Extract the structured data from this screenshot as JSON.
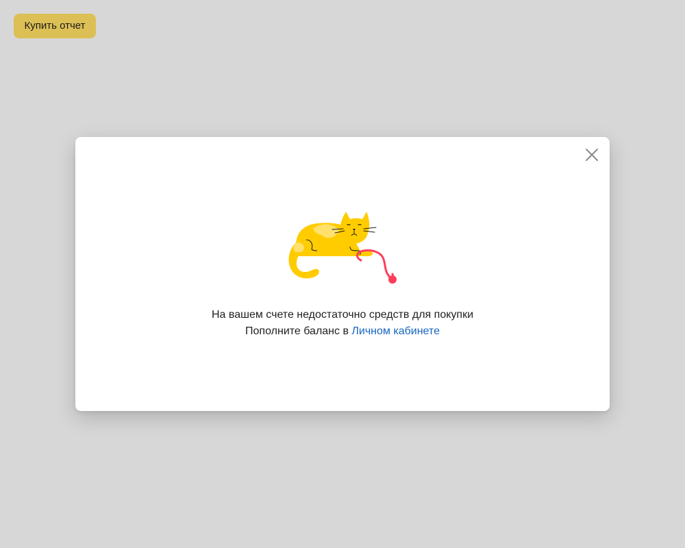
{
  "toolbar": {
    "buy_report_label": "Купить отчет"
  },
  "modal": {
    "message_line1": "На вашем счете недостаточно средств для покупки",
    "message_line2_prefix": "Пополните баланс в ",
    "cabinet_link_label": "Личном кабинете",
    "close_icon": "close-icon",
    "illustration": "cat-with-yarn-icon"
  },
  "colors": {
    "background": "#d7d7d7",
    "button": "#dcbf55",
    "link": "#1565c0",
    "cat_yellow": "#ffcc00",
    "yarn_red": "#ff3d5a"
  }
}
